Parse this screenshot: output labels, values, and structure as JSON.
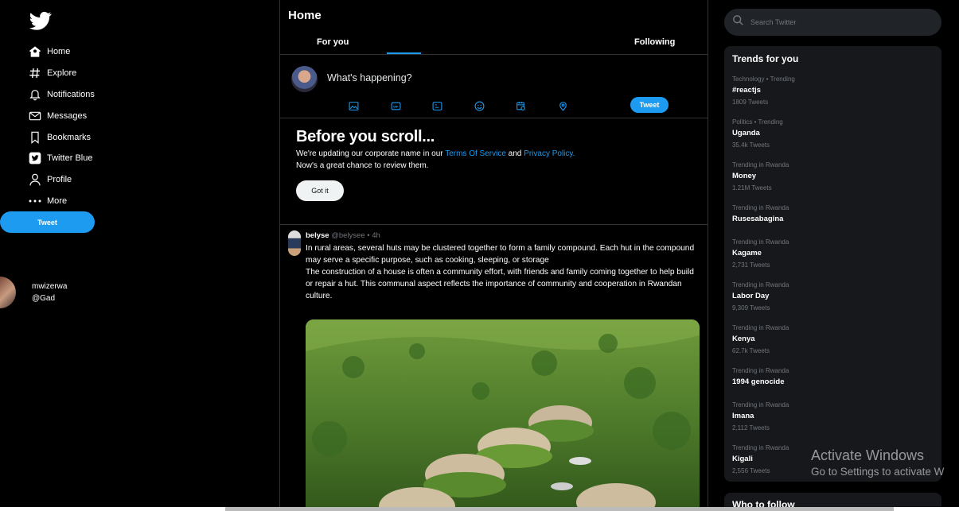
{
  "sidebar": {
    "items": [
      {
        "label": "Home",
        "icon": "home-icon"
      },
      {
        "label": "Explore",
        "icon": "hashtag-icon"
      },
      {
        "label": "Notifications",
        "icon": "bell-icon"
      },
      {
        "label": "Messages",
        "icon": "envelope-icon"
      },
      {
        "label": "Bookmarks",
        "icon": "bookmark-icon"
      },
      {
        "label": "Twitter Blue",
        "icon": "twitter-blue-icon"
      },
      {
        "label": "Profile",
        "icon": "person-icon"
      },
      {
        "label": "More",
        "icon": "more-dots-icon"
      }
    ],
    "tweet_label": "Tweet",
    "account": {
      "name": "mwizerwa",
      "handle": "@Gad"
    }
  },
  "main": {
    "title": "Home",
    "tabs": [
      {
        "label": "For you"
      },
      {
        "label": "Following"
      }
    ],
    "composer": {
      "placeholder": "What's happening?",
      "tweet_label": "Tweet"
    },
    "notice": {
      "title": "Before you scroll...",
      "line1_prefix": "We're updating our corporate name in our ",
      "terms_link": "Terms Of Service",
      "and": " and ",
      "privacy_link": "Privacy Policy.",
      "line2": "Now's a great chance to review them.",
      "button": "Got it"
    },
    "tweet": {
      "name": "belyse",
      "handle": "@belysee",
      "time": "• 4h",
      "para1": "In rural areas, several huts may be clustered together to form a family compound. Each hut in the compound may serve a specific purpose, such as cooking, sleeping, or storage",
      "para2": "The construction of a house is often a community effort, with friends and family coming together to help build or repair a hut. This communal aspect reflects the importance of community and cooperation in Rwandan culture."
    }
  },
  "right": {
    "search_placeholder": "Search Twitter",
    "trends_title": "Trends for you",
    "trends": [
      {
        "context": "Technology • Trending",
        "name": "#reactjs",
        "count": "1809 Tweets"
      },
      {
        "context": "Politics • Trending",
        "name": "Uganda",
        "count": "35.4k Tweets"
      },
      {
        "context": "Trending in Rwanda",
        "name": "Money",
        "count": "1.21M Tweets"
      },
      {
        "context": "Trending in Rwanda",
        "name": "Rusesabagina",
        "count": ""
      },
      {
        "context": "Trending in Rwanda",
        "name": "Kagame",
        "count": "2,731 Tweets"
      },
      {
        "context": "Trending in Rwanda",
        "name": "Labor Day",
        "count": "9,309 Tweets"
      },
      {
        "context": "Trending in Rwanda",
        "name": "Kenya",
        "count": "62.7k Tweets"
      },
      {
        "context": "Trending in Rwanda",
        "name": "1994 genocide",
        "count": ""
      },
      {
        "context": "Trending in Rwanda",
        "name": "Imana",
        "count": "2,112 Tweets"
      },
      {
        "context": "Trending in Rwanda",
        "name": "Kigali",
        "count": "2,556 Tweets"
      }
    ],
    "who_to_follow": "Who to follow"
  },
  "watermark": {
    "line1": "Activate Windows",
    "line2": "Go to Settings to activate W"
  },
  "colors": {
    "accent": "#1d9bf0",
    "background": "#000000",
    "panel": "#16181c"
  }
}
